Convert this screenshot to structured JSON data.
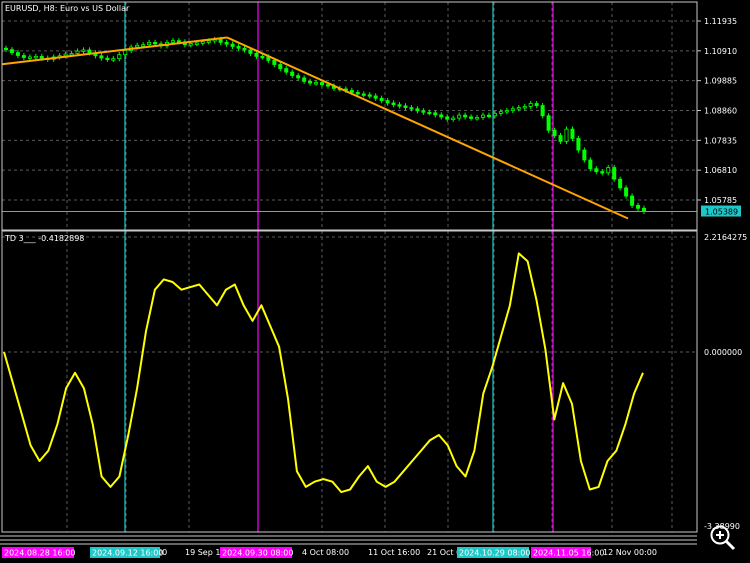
{
  "symbol_label": "EURUSD, H8:  Euro vs US Dollar",
  "indicator_label": "TD 3___ -0.4182898",
  "price_box": "1.05389",
  "colors": {
    "background": "#000000",
    "grid": "#5a5a5a",
    "candle": "#00ff00",
    "trend": "#ffa500",
    "indicator": "#ffff00",
    "vline_cyan": "#1ec8c8",
    "vline_magenta": "#ff00ff",
    "price_line": "#1ec8c8"
  },
  "icons": {
    "zoom": "magnifier-zoom-icon"
  },
  "chart_data": [
    {
      "type": "candlestick",
      "title": "EURUSD, H8:  Euro vs US Dollar",
      "ylim": [
        1.0482,
        1.1225
      ],
      "y_ticks": [
        "1.11935",
        "1.10910",
        "1.09885",
        "1.08860",
        "1.07835",
        "1.06810",
        "1.05785"
      ],
      "y_tick_values": [
        1.11935,
        1.1091,
        1.09885,
        1.0886,
        1.07835,
        1.0681,
        1.05785
      ],
      "current_price": 1.05389,
      "close": [
        1.1095,
        1.1085,
        1.1075,
        1.1068,
        1.107,
        1.1072,
        1.1066,
        1.1062,
        1.107,
        1.1074,
        1.108,
        1.1082,
        1.109,
        1.1094,
        1.1084,
        1.1074,
        1.1066,
        1.1062,
        1.1064,
        1.1078,
        1.1092,
        1.1104,
        1.111,
        1.1112,
        1.112,
        1.1115,
        1.1108,
        1.112,
        1.1126,
        1.1122,
        1.1112,
        1.1116,
        1.1118,
        1.1122,
        1.1125,
        1.113,
        1.112,
        1.1114,
        1.1106,
        1.11,
        1.1094,
        1.1082,
        1.1072,
        1.107,
        1.1058,
        1.1044,
        1.103,
        1.1018,
        1.1006,
        1.0998,
        1.0986,
        1.098,
        1.0982,
        1.0975,
        1.097,
        1.0962,
        1.096,
        1.0955,
        1.0948,
        1.0943,
        1.094,
        1.0936,
        1.0928,
        1.092,
        1.0912,
        1.0906,
        1.0902,
        1.0896,
        1.0892,
        1.0885,
        1.088,
        1.0878,
        1.0871,
        1.0864,
        1.0856,
        1.086,
        1.087,
        1.0864,
        1.086,
        1.0862,
        1.087,
        1.0868,
        1.0876,
        1.0882,
        1.0886,
        1.0892,
        1.0896,
        1.09,
        1.091,
        1.0903,
        1.0868,
        1.0818,
        1.08,
        1.078,
        1.0822,
        1.079,
        1.075,
        1.0716,
        1.0686,
        1.0676,
        1.0672,
        1.069,
        1.065,
        1.062,
        1.0592,
        1.056,
        1.055,
        1.0539
      ],
      "trendlines": [
        {
          "start": {
            "bar": 0,
            "price": 1.1045
          },
          "end": {
            "bar": 33,
            "price": 1.1137
          }
        },
        {
          "start": {
            "bar": 33,
            "price": 1.1137
          },
          "end": {
            "bar": 93,
            "price": 1.0515
          }
        }
      ],
      "vertical_lines": [
        {
          "label": "2024.08.28 16:00",
          "color": "magenta"
        },
        {
          "label": "2024.09.12 16:00",
          "color": "cyan"
        },
        {
          "label": "2024.09.30 08:00",
          "color": "magenta"
        },
        {
          "label": "2024.10.29 08:00",
          "color": "cyan"
        },
        {
          "label": "2024.11.05 16:00",
          "color": "magenta"
        }
      ]
    },
    {
      "type": "line",
      "title": "TD 3___ -0.4182898",
      "ylim": [
        -3.5,
        2.2164275
      ],
      "y_ticks": [
        "2.2164275",
        "0.000000",
        "-3.38990"
      ],
      "y_tick_values": [
        2.2164275,
        0.0,
        -3.5
      ],
      "last_value": -0.4182898,
      "x": [
        0,
        0.25,
        0.5,
        0.75,
        1,
        1.25,
        1.5,
        1.75,
        2,
        2.25,
        2.5,
        2.75,
        3,
        3.25,
        3.5,
        3.75,
        4,
        4.25,
        4.5,
        4.75,
        5,
        5.25,
        5.5,
        5.75,
        6,
        6.25,
        6.5,
        6.75,
        7,
        7.25,
        7.5,
        7.75,
        8,
        8.25,
        8.5,
        8.75,
        9,
        9.25,
        9.5,
        9.75,
        10,
        10.25,
        10.5,
        10.75,
        11,
        11.25,
        11.5,
        11.75,
        12,
        12.25,
        12.5,
        12.75,
        13,
        13.25,
        13.5,
        13.75,
        14,
        14.25,
        14.5,
        14.75,
        15,
        15.25,
        15.5,
        15.75,
        16,
        16.25,
        16.5,
        16.75,
        17,
        17.25,
        17.5,
        17.75,
        18
      ],
      "series": [
        {
          "values": [
            0.0,
            -0.6,
            -1.2,
            -1.8,
            -2.1,
            -1.9,
            -1.4,
            -0.7,
            -0.4,
            -0.7,
            -1.4,
            -2.4,
            -2.6,
            -2.4,
            -1.6,
            -0.7,
            0.4,
            1.2,
            1.4,
            1.35,
            1.2,
            1.25,
            1.3,
            1.1,
            0.9,
            1.2,
            1.3,
            0.9,
            0.6,
            0.9,
            0.5,
            0.1,
            -0.9,
            -2.3,
            -2.6,
            -2.5,
            -2.45,
            -2.5,
            -2.7,
            -2.65,
            -2.4,
            -2.2,
            -2.5,
            -2.6,
            -2.5,
            -2.3,
            -2.1,
            -1.9,
            -1.7,
            -1.6,
            -1.8,
            -2.2,
            -2.4,
            -1.9,
            -0.8,
            -0.3,
            0.3,
            0.9,
            1.9,
            1.75,
            1.0,
            0.05,
            -1.3,
            -0.6,
            -1.0,
            -2.1,
            -2.65,
            -2.6,
            -2.1,
            -1.9,
            -1.4,
            -0.8,
            -0.4
          ]
        }
      ]
    }
  ],
  "x_axis": {
    "tick_labels": [
      "ep 19",
      "00",
      "19 Sep 16:00",
      "4 Oct 08:00",
      "11 Oct 16:00",
      "21 Oct 0",
      "2024.10.29 08:00",
      "",
      "12 Nov 00:00"
    ],
    "boxed_labels": [
      {
        "text": "2024.08.28 16:00",
        "color": "magenta"
      },
      {
        "text": "2024.09.12 16:00",
        "color": "cyan"
      },
      {
        "text": "2024.09.30 08:00",
        "color": "magenta"
      },
      {
        "text": "2024.10.29 08:00",
        "color": "cyan"
      },
      {
        "text": "2024.11.05 16:00",
        "color": "magenta"
      }
    ],
    "plain_labels": [
      "00",
      "19 Sep 16",
      "4 Oct 08:00",
      "11 Oct 16:00",
      "21 Oct 0",
      "12 Nov 00:00"
    ]
  }
}
